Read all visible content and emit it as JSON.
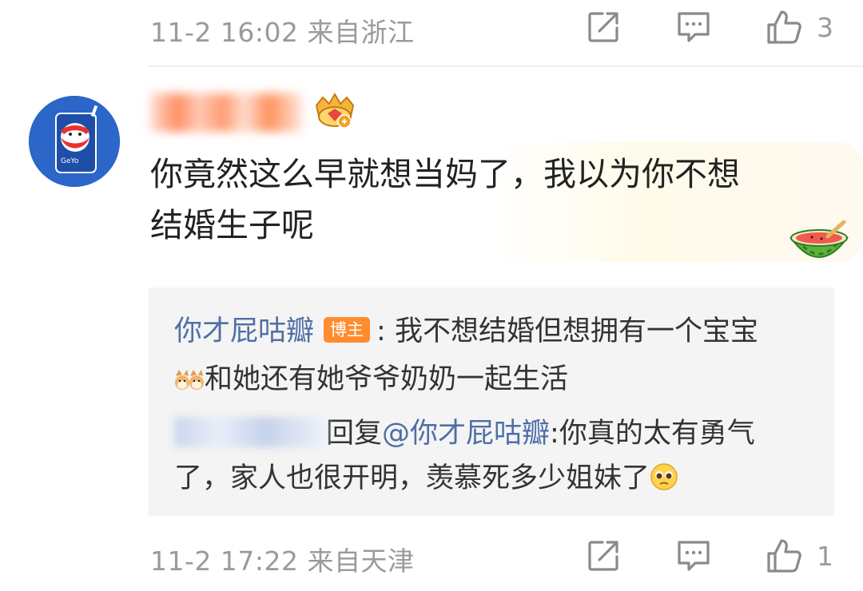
{
  "top_meta": {
    "time_location": "11-2 16:02 来自浙江",
    "like_count": "3"
  },
  "comment": {
    "text_line1": "你竟然这么早就想当妈了，我以为你不想",
    "text_line2": "结婚生子呢",
    "avatar_brand_text": "GeYo"
  },
  "reply_thread": {
    "first_reply": {
      "author": "你才屁咕瓣",
      "role_badge": "博主",
      "separator": ": ",
      "text_line1": "我不想结婚但想拥有一个宝宝",
      "text_line2": "和她还有她爷爷奶奶一起生活"
    },
    "second_reply": {
      "reply_word": "回复",
      "mention": "@你才屁咕瓣",
      "text_line1": ":你真的太有勇气",
      "text_line2": "了，家人也很开明，羡慕死多少姐妹了"
    }
  },
  "bottom_meta": {
    "time_location": "11-2 17:22 来自天津",
    "like_count": "1"
  },
  "icons": [
    "share-icon",
    "comment-icon",
    "like-icon",
    "crown-badge-icon",
    "watermelon-icon",
    "shiba-emoji-icon",
    "pleading-face-emoji-icon"
  ],
  "colors": {
    "link": "#4f6fa6",
    "meta_gray": "#9a9a9a",
    "blogger_badge": "#ff8c2e",
    "reply_bg": "#f4f4f4",
    "avatar_bg": "#2b66c8"
  }
}
